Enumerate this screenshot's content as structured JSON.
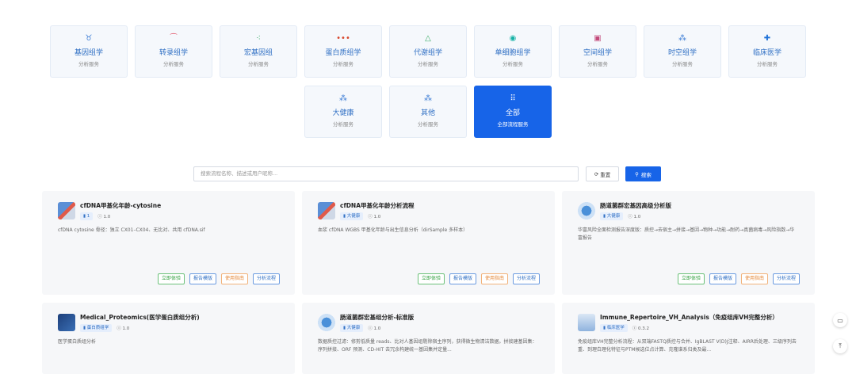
{
  "categories_row1": [
    {
      "icon": "dna-icon",
      "glyph": "♉",
      "name": "基因组学",
      "sub": "分析服务",
      "color": "#3a7bd5"
    },
    {
      "icon": "transcript-icon",
      "glyph": "⁀",
      "name": "转录组学",
      "sub": "分析服务",
      "color": "#e0455a"
    },
    {
      "icon": "metagenome-icon",
      "glyph": "⁖",
      "name": "宏基因组",
      "sub": "分析服务",
      "color": "#3fae6a"
    },
    {
      "icon": "protein-icon",
      "glyph": "•••",
      "name": "蛋白质组学",
      "sub": "分析服务",
      "color": "#d8452a"
    },
    {
      "icon": "flask-icon",
      "glyph": "△",
      "name": "代谢组学",
      "sub": "分析服务",
      "color": "#3fae6a"
    },
    {
      "icon": "cell-icon",
      "glyph": "◉",
      "name": "单细胞组学",
      "sub": "分析服务",
      "color": "#16b2a6"
    },
    {
      "icon": "spatial-icon",
      "glyph": "▣",
      "name": "空间组学",
      "sub": "分析服务",
      "color": "#c24a7a"
    },
    {
      "icon": "spatiotemporal-icon",
      "glyph": "⁂",
      "name": "时空组学",
      "sub": "分析服务",
      "color": "#3a7bd5"
    },
    {
      "icon": "medical-cross-icon",
      "glyph": "✚",
      "name": "临床医学",
      "sub": "分析服务",
      "color": "#1f72d8"
    }
  ],
  "categories_row2": [
    {
      "icon": "health-icon",
      "glyph": "⁂",
      "name": "大健康",
      "sub": "分析服务",
      "color": "#3a7bd5"
    },
    {
      "icon": "other-icon",
      "glyph": "⁂",
      "name": "其他",
      "sub": "分析服务",
      "color": "#3a7bd5"
    },
    {
      "icon": "grid-icon",
      "glyph": "⠿",
      "name": "全部",
      "sub": "全部流程服务",
      "color": "#ffffff"
    }
  ],
  "search": {
    "placeholder": "搜索流程名称、描述或用户昵称...",
    "reset_label": "重置",
    "search_label": "搜索"
  },
  "cards": [
    {
      "title": "cfDNA甲基化年龄-cytosine",
      "tag": "1",
      "version": "1.0",
      "desc": "cfDNA cytosine 骨径：独立 CX01–CX04、无比对、共用 cfDNA.sif",
      "icon": "methylation-icon",
      "has_actions": true
    },
    {
      "title": "cfDNA甲基化年龄分析流程",
      "tag": "大健康",
      "version": "1.0",
      "desc": "血浆 cfDNA WGBS 甲基化年龄与出生信息分析（dirSample 多样本）",
      "icon": "methylation-icon",
      "has_actions": true
    },
    {
      "title": "肠道菌群宏基因高级分析版",
      "tag": "大健康",
      "version": "1.0",
      "desc": "华富风险全面检测报告深度版：质控→去宿主→拼接→基因→物种→功能→耐药→真菌病毒→风险指数→华富报告",
      "icon": "bacteria-icon",
      "has_actions": true
    },
    {
      "title": "Medical_Proteomics(医学蛋白质组分析)",
      "tag": "蛋白质组学",
      "version": "1.0",
      "desc": "医学蛋白质组分析",
      "icon": "proteomics-icon",
      "has_actions": false
    },
    {
      "title": "肠道菌群宏基组分析-标准版",
      "tag": "大健康",
      "version": "1.0",
      "desc": "数据质控过滤：修剪低质量 reads、比对人基因组剔除宿主序列，获得微生物清洁数据。拼接建基因集：序列拼接、ORF 预测、CD-HIT 去冗余构建统一基因集并定量...",
      "icon": "bacteria-icon",
      "has_actions": false
    },
    {
      "title": "Immune_Repertoire_VH_Analysis（免疫组库VH完整分析）",
      "tag": "临床医学",
      "version": "0.3.2",
      "desc": "免疫组库VH完整分析流程：从双端FASTQ质控与合并、IgBLAST V(D)J注释、AIRR后处理、三级序列去重、到理白理化特征与PTM候选位点计算、克隆谱系归类及最...",
      "icon": "immune-icon",
      "has_actions": false
    }
  ],
  "actions": {
    "try": "立即体验",
    "template": "报告模版",
    "guide": "使用指南",
    "flow": "分析流程"
  },
  "side": {
    "chat_icon": "chat-icon",
    "top_icon": "back-to-top-icon"
  }
}
